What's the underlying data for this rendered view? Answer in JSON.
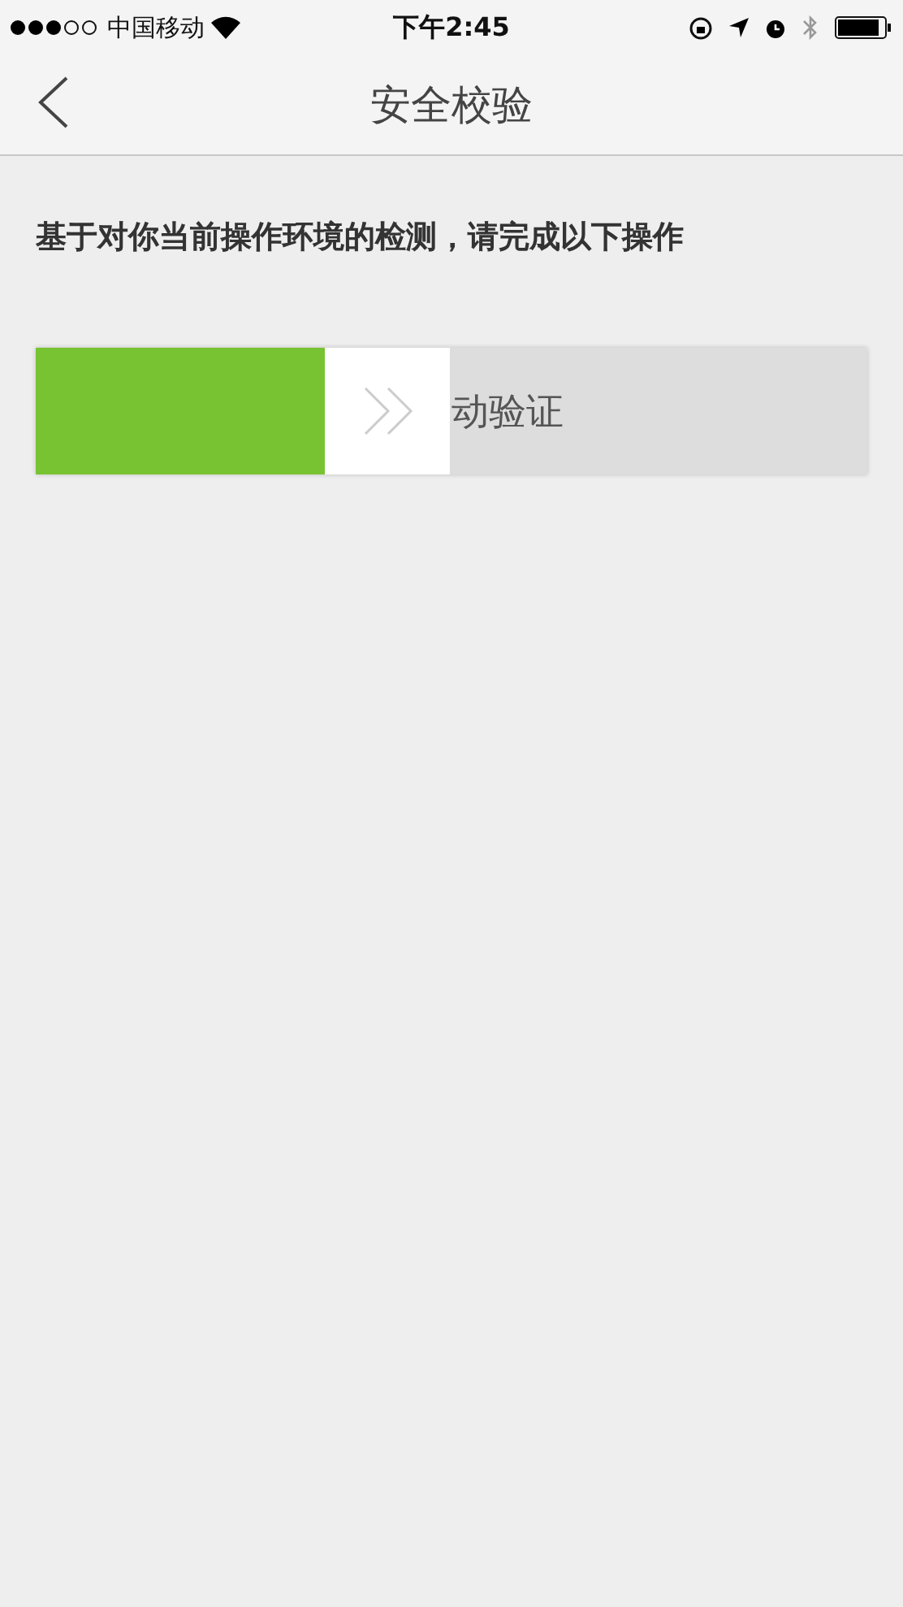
{
  "status_bar": {
    "carrier": "中国移动",
    "time": "下午2:45"
  },
  "nav": {
    "title": "安全校验"
  },
  "prompt": "基于对你当前操作环境的检测，请完成以下操作",
  "slider": {
    "label": "动验证",
    "level": 0.348
  }
}
